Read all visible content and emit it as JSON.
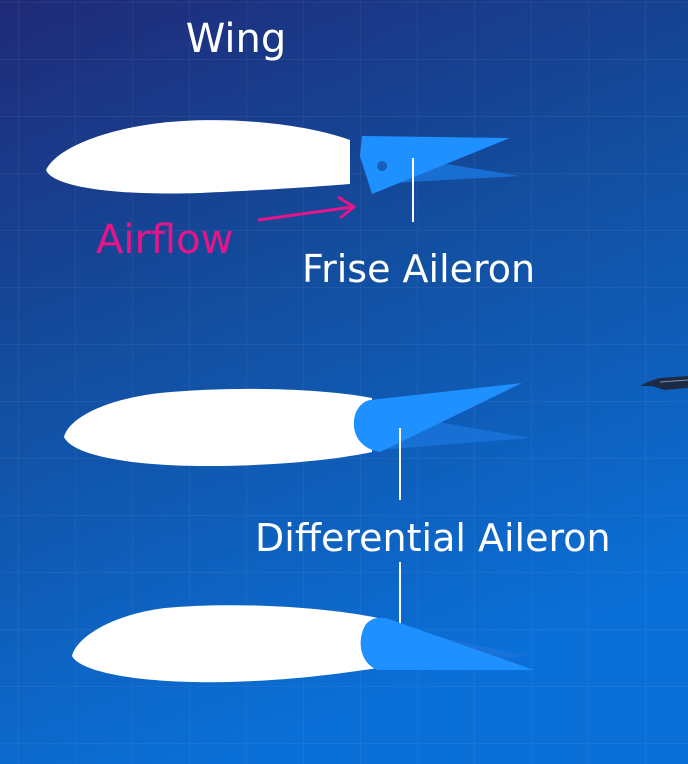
{
  "labels": {
    "wing": "Wing",
    "airflow": "Airflow",
    "frise_aileron": "Frise Aileron",
    "differential_aileron": "Differential Aileron"
  },
  "colors": {
    "background_top": "#1e2a78",
    "background_bottom": "#0a6fd6",
    "grid": "#ffffff",
    "airfoil": "#ffffff",
    "aileron": "#1e90ff",
    "aileron_ghost": "#1677d9",
    "airflow": "#e8148a",
    "label_text": "#ffffff"
  },
  "icons": {
    "aircraft": "aircraft-silhouette-icon"
  }
}
